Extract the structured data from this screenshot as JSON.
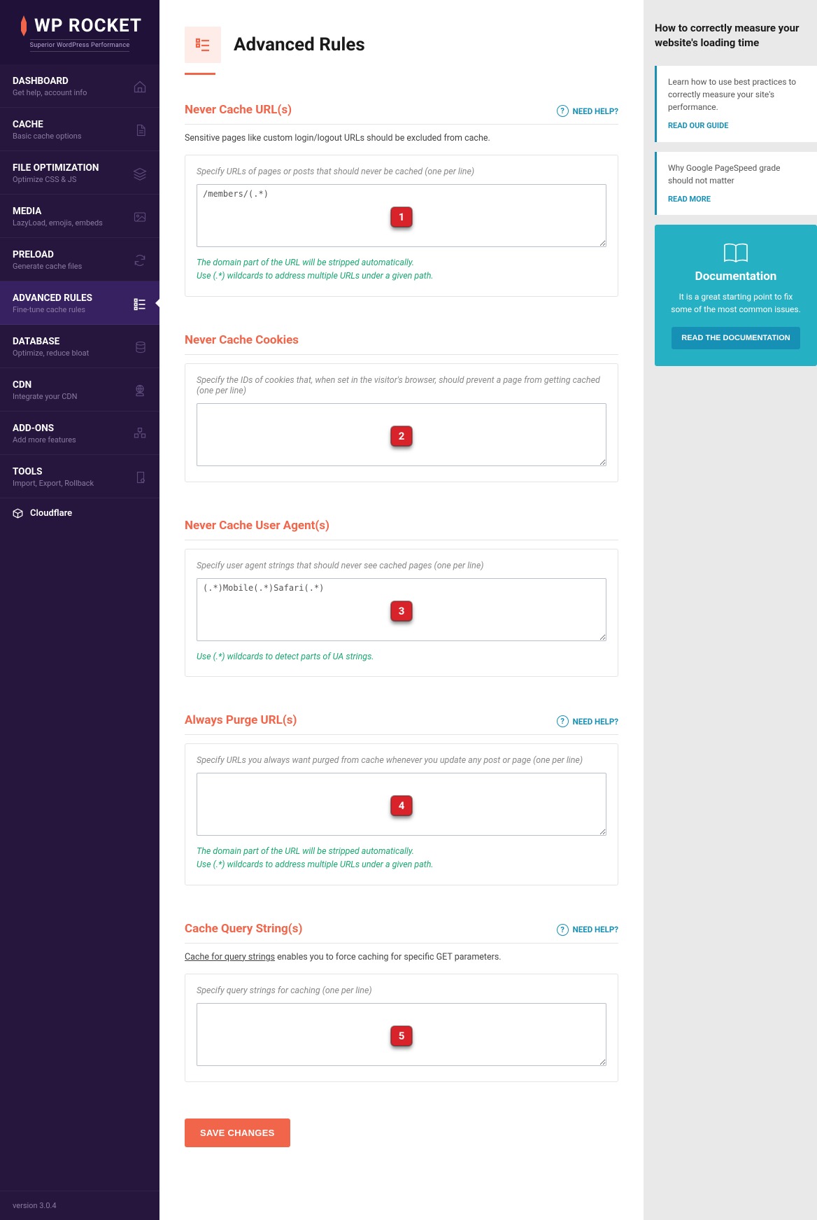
{
  "logo": {
    "text": "WP ROCKET",
    "tagline": "Superior WordPress Performance"
  },
  "version": "version 3.0.4",
  "nav": [
    {
      "title": "DASHBOARD",
      "sub": "Get help, account info",
      "icon": "home"
    },
    {
      "title": "CACHE",
      "sub": "Basic cache options",
      "icon": "file"
    },
    {
      "title": "FILE OPTIMIZATION",
      "sub": "Optimize CSS & JS",
      "icon": "layers"
    },
    {
      "title": "MEDIA",
      "sub": "LazyLoad, emojis, embeds",
      "icon": "image"
    },
    {
      "title": "PRELOAD",
      "sub": "Generate cache files",
      "icon": "refresh"
    },
    {
      "title": "ADVANCED RULES",
      "sub": "Fine-tune cache rules",
      "icon": "list",
      "active": true
    },
    {
      "title": "DATABASE",
      "sub": "Optimize, reduce bloat",
      "icon": "database"
    },
    {
      "title": "CDN",
      "sub": "Integrate your CDN",
      "icon": "globe-hand"
    },
    {
      "title": "ADD-ONS",
      "sub": "Add more features",
      "icon": "boxes"
    },
    {
      "title": "TOOLS",
      "sub": "Import, Export, Rollback",
      "icon": "page-gear"
    }
  ],
  "cloudflare_label": "Cloudflare",
  "page": {
    "title": "Advanced Rules"
  },
  "need_help": "NEED HELP?",
  "sections": [
    {
      "id": "never-cache-urls",
      "title": "Never Cache URL(s)",
      "help": true,
      "desc": "Sensitive pages like custom login/logout URLs should be excluded from cache.",
      "label": "Specify URLs of pages or posts that should never be cached (one per line)",
      "value": "/members/(.*)",
      "hint": "The domain part of the URL will be stripped automatically.\nUse (.*) wildcards to address multiple URLs under a given path.",
      "marker": "1"
    },
    {
      "id": "never-cache-cookies",
      "title": "Never Cache Cookies",
      "help": false,
      "desc": "",
      "label": "Specify the IDs of cookies that, when set in the visitor's browser, should prevent a page from getting cached (one per line)",
      "value": "",
      "hint": "",
      "marker": "2"
    },
    {
      "id": "never-cache-user-agents",
      "title": "Never Cache User Agent(s)",
      "help": false,
      "desc": "",
      "label": "Specify user agent strings that should never see cached pages (one per line)",
      "value": "(.*)Mobile(.*)Safari(.*)",
      "hint": "Use (.*) wildcards to detect parts of UA strings.",
      "marker": "3"
    },
    {
      "id": "always-purge-urls",
      "title": "Always Purge URL(s)",
      "help": true,
      "desc": "",
      "label": "Specify URLs you always want purged from cache whenever you update any post or page (one per line)",
      "value": "",
      "hint": "The domain part of the URL will be stripped automatically.\nUse (.*) wildcards to address multiple URLs under a given path.",
      "marker": "4"
    },
    {
      "id": "cache-query-strings",
      "title": "Cache Query String(s)",
      "help": true,
      "desc_html": true,
      "desc_link": "Cache for query strings",
      "desc_rest": " enables you to force caching for specific GET parameters.",
      "label": "Specify query strings for caching (one per line)",
      "value": "",
      "hint": "",
      "marker": "5"
    }
  ],
  "save_label": "SAVE CHANGES",
  "aside": {
    "headline": "How to correctly measure your website's loading time",
    "cards": [
      {
        "text": "Learn how to use best practices to correctly measure your site's performance.",
        "link": "READ OUR GUIDE"
      },
      {
        "text": "Why Google PageSpeed grade should not matter",
        "link": "READ MORE"
      }
    ],
    "doc": {
      "title": "Documentation",
      "text": "It is a great starting point to fix some of the most common issues.",
      "button": "READ THE DOCUMENTATION"
    }
  }
}
